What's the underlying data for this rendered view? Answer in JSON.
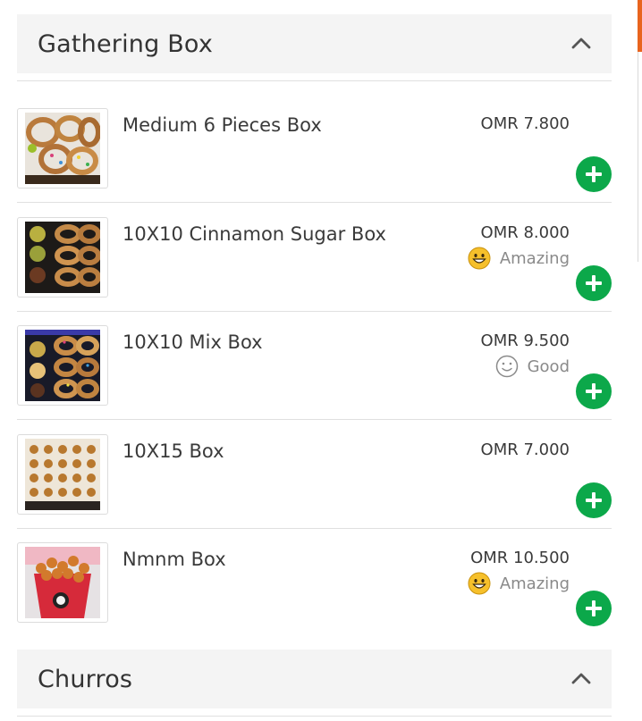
{
  "sections": [
    {
      "title": "Gathering Box",
      "items": [
        {
          "name": "Medium 6 Pieces Box",
          "price": "OMR 7.800",
          "rating": null,
          "rating_icon": null
        },
        {
          "name": "10X10 Cinnamon Sugar Box",
          "price": "OMR 8.000",
          "rating": "Amazing",
          "rating_icon": "grinning-face-icon"
        },
        {
          "name": "10X10 Mix Box",
          "price": "OMR 9.500",
          "rating": "Good",
          "rating_icon": "smiling-face-outline-icon"
        },
        {
          "name": "10X15 Box",
          "price": "OMR 7.000",
          "rating": null,
          "rating_icon": null
        },
        {
          "name": "Nmnm Box",
          "price": "OMR 10.500",
          "rating": "Amazing",
          "rating_icon": "grinning-face-icon"
        }
      ]
    },
    {
      "title": "Churros",
      "items": []
    }
  ],
  "colors": {
    "add_button": "#0ca84a",
    "header_bg": "#f4f4f4",
    "accent_orange": "#e8641e",
    "emoji_yellow": "#f6c02b"
  },
  "icons": {
    "collapse": "chevron-up-icon",
    "add": "plus-circle-icon"
  }
}
